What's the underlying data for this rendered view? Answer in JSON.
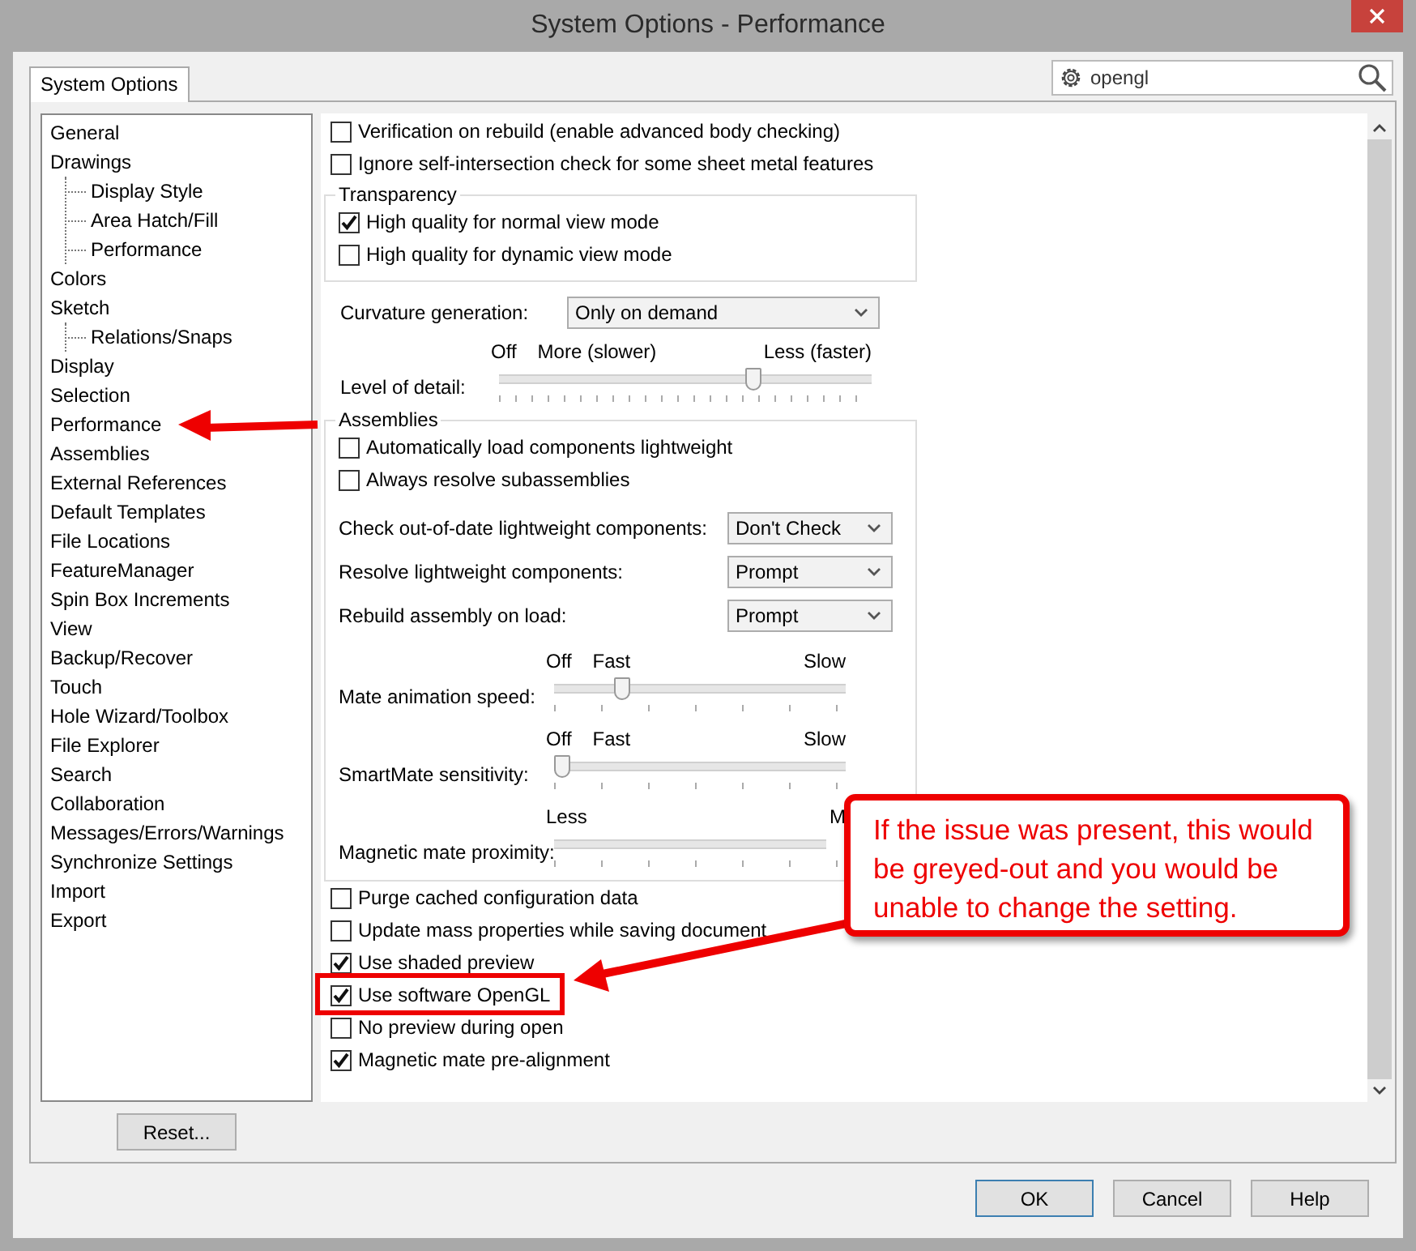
{
  "window": {
    "title": "System Options - Performance"
  },
  "tabs": [
    {
      "label": "System Options",
      "selected": true
    }
  ],
  "search": {
    "value": "opengl"
  },
  "tree": [
    {
      "label": "General"
    },
    {
      "label": "Drawings",
      "children": [
        {
          "label": "Display Style"
        },
        {
          "label": "Area Hatch/Fill"
        },
        {
          "label": "Performance"
        }
      ]
    },
    {
      "label": "Colors"
    },
    {
      "label": "Sketch",
      "children": [
        {
          "label": "Relations/Snaps"
        }
      ]
    },
    {
      "label": "Display"
    },
    {
      "label": "Selection"
    },
    {
      "label": "Performance"
    },
    {
      "label": "Assemblies"
    },
    {
      "label": "External References"
    },
    {
      "label": "Default Templates"
    },
    {
      "label": "File Locations"
    },
    {
      "label": "FeatureManager"
    },
    {
      "label": "Spin Box Increments"
    },
    {
      "label": "View"
    },
    {
      "label": "Backup/Recover"
    },
    {
      "label": "Touch"
    },
    {
      "label": "Hole Wizard/Toolbox"
    },
    {
      "label": "File Explorer"
    },
    {
      "label": "Search"
    },
    {
      "label": "Collaboration"
    },
    {
      "label": "Messages/Errors/Warnings"
    },
    {
      "label": "Synchronize Settings"
    },
    {
      "label": "Import"
    },
    {
      "label": "Export"
    }
  ],
  "reset_button": "Reset...",
  "options": [
    {
      "kind": "checkbox",
      "label": "Verification on rebuild (enable advanced body checking)",
      "checked": false
    },
    {
      "kind": "checkbox",
      "label": "Ignore self-intersection check for some sheet metal features",
      "checked": false
    },
    {
      "kind": "group",
      "title": "Transparency",
      "items": [
        {
          "kind": "checkbox",
          "label": "High quality for normal view mode",
          "checked": true
        },
        {
          "kind": "checkbox",
          "label": "High quality for dynamic view mode",
          "checked": false
        }
      ]
    },
    {
      "kind": "dropdown",
      "label": "Curvature generation:",
      "value": "Only on demand"
    },
    {
      "kind": "slider",
      "label": "Level of detail:",
      "marks": [
        "Off",
        "More (slower)",
        "Less (faster)"
      ],
      "level": 0.69
    },
    {
      "kind": "group",
      "title": "Assemblies",
      "items": [
        {
          "kind": "checkbox",
          "label": "Automatically load components lightweight",
          "checked": false
        },
        {
          "kind": "checkbox",
          "label": "Always resolve subassemblies",
          "checked": false
        },
        {
          "kind": "dropdown",
          "label": "Check out-of-date lightweight components:",
          "value": "Don't Check"
        },
        {
          "kind": "dropdown",
          "label": "Resolve lightweight components:",
          "value": "Prompt"
        },
        {
          "kind": "dropdown",
          "label": "Rebuild assembly on load:",
          "value": "Prompt"
        },
        {
          "kind": "slider",
          "label": "Mate animation speed:",
          "marks": [
            "Off",
            "Fast",
            "Slow"
          ],
          "level": 0.22
        },
        {
          "kind": "slider",
          "label": "SmartMate sensitivity:",
          "marks": [
            "Off",
            "Fast",
            "Slow"
          ],
          "level": 0
        },
        {
          "kind": "slider",
          "label": "Magnetic mate proximity:",
          "marks": [
            "Less",
            "M"
          ]
        }
      ]
    },
    {
      "kind": "checkbox",
      "label": "Purge cached configuration data",
      "checked": false
    },
    {
      "kind": "checkbox",
      "label": "Update mass properties while saving document",
      "checked": false
    },
    {
      "kind": "checkbox",
      "label": "Use shaded preview",
      "checked": true
    },
    {
      "kind": "checkbox",
      "label": "Use software OpenGL",
      "checked": true
    },
    {
      "kind": "checkbox",
      "label": "No preview during open",
      "checked": false
    },
    {
      "kind": "checkbox",
      "label": "Magnetic mate pre-alignment",
      "checked": true
    }
  ],
  "buttons": [
    "OK",
    "Cancel",
    "Help"
  ],
  "annotation": {
    "callout": "If the issue was present, this would be greyed-out and you would be unable to change the setting."
  }
}
